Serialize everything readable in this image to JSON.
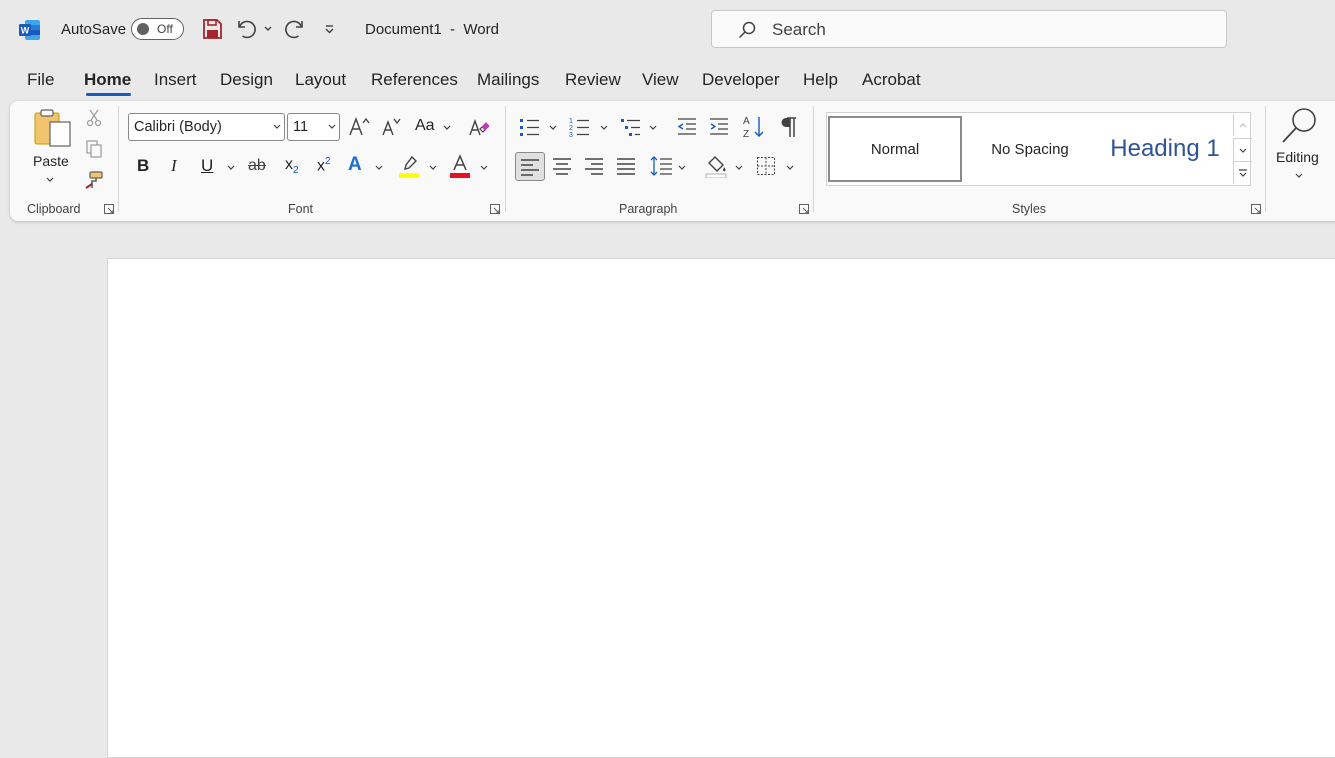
{
  "title_bar": {
    "autosave_label": "AutoSave",
    "autosave_state": "Off",
    "document_title": "Document1  -  Word",
    "search_placeholder": "Search"
  },
  "tabs": [
    {
      "label": "File"
    },
    {
      "label": "Home",
      "active": true
    },
    {
      "label": "Insert"
    },
    {
      "label": "Design"
    },
    {
      "label": "Layout"
    },
    {
      "label": "References"
    },
    {
      "label": "Mailings"
    },
    {
      "label": "Review"
    },
    {
      "label": "View"
    },
    {
      "label": "Developer"
    },
    {
      "label": "Help"
    },
    {
      "label": "Acrobat"
    }
  ],
  "ribbon": {
    "clipboard": {
      "label": "Clipboard",
      "paste_label": "Paste"
    },
    "font": {
      "label": "Font",
      "font_name": "Calibri (Body)",
      "font_size": "11",
      "change_case_label": "Aa",
      "strike_label": "ab"
    },
    "paragraph": {
      "label": "Paragraph"
    },
    "styles": {
      "label": "Styles",
      "items": [
        "Normal",
        "No Spacing",
        "Heading 1"
      ]
    },
    "editing": {
      "label": "Editing"
    }
  },
  "colors": {
    "accent": "#185abd",
    "highlight": "#ffff00",
    "font_color": "#e81123",
    "heading_blue": "#2f5496"
  }
}
